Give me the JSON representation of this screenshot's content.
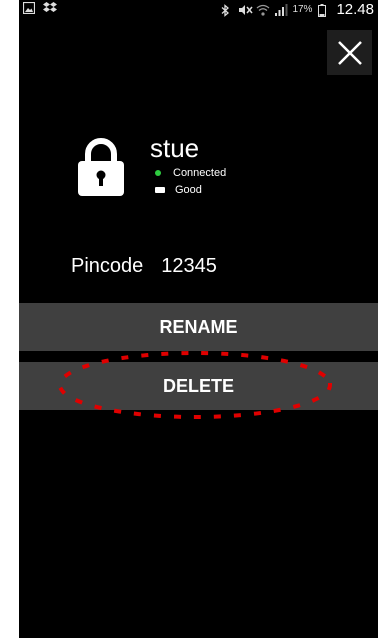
{
  "statusbar": {
    "battery_percent": "17%",
    "time": "12.48"
  },
  "device": {
    "name": "stue",
    "connection_status": "Connected",
    "battery_status": "Good"
  },
  "pincode": {
    "label": "Pincode",
    "value": "12345"
  },
  "actions": {
    "rename_label": "RENAME",
    "delete_label": "DELETE"
  },
  "colors": {
    "background": "#000000",
    "button_bg": "#404040",
    "connected_dot": "#2ecc40",
    "annotation": "#e00000"
  },
  "icons": [
    "image-icon",
    "dropbox-icon",
    "bluetooth-icon",
    "mute-icon",
    "wifi-icon",
    "signal-icon",
    "battery-icon",
    "close-icon",
    "lock-icon"
  ]
}
